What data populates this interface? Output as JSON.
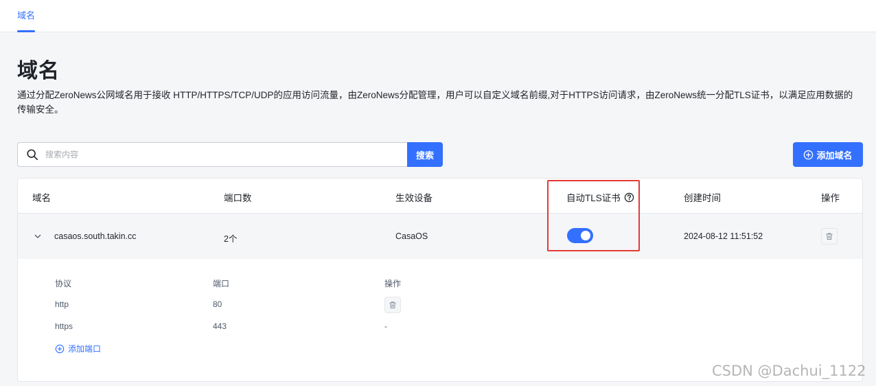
{
  "topbar": {
    "tab_label": "域名"
  },
  "page": {
    "title": "域名",
    "description": "通过分配ZeroNews公网域名用于接收 HTTP/HTTPS/TCP/UDP的应用访问流量，由ZeroNews分配管理，用户可以自定义域名前缀,对于HTTPS访问请求，由ZeroNews统一分配TLS证书，以满足应用数据的传输安全。"
  },
  "search": {
    "placeholder": "搜索内容",
    "button_label": "搜索"
  },
  "add_domain": {
    "label": "添加域名"
  },
  "table": {
    "headers": {
      "domain": "域名",
      "ports": "端口数",
      "device": "生效设备",
      "auto_tls": "自动TLS证书",
      "created": "创建时间",
      "actions": "操作"
    },
    "rows": [
      {
        "domain": "casaos.south.takin.cc",
        "ports": "2个",
        "device": "CasaOS",
        "auto_tls_enabled": true,
        "created": "2024-08-12 11:51:52"
      }
    ],
    "sub": {
      "headers": {
        "protocol": "协议",
        "port": "端口",
        "actions": "操作"
      },
      "rows": [
        {
          "protocol": "http",
          "port": "80",
          "action": ""
        },
        {
          "protocol": "https",
          "port": "443",
          "action": "-"
        }
      ],
      "add_port_label": "添加端口"
    }
  },
  "watermark": "CSDN @Dachui_1122",
  "colors": {
    "accent": "#3370ff",
    "highlight_box": "#e53935"
  }
}
